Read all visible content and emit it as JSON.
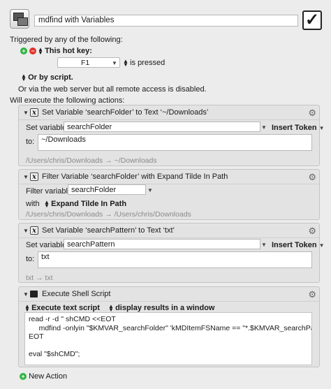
{
  "macro": {
    "name": "mdfind with Variables",
    "enabled_mark": "✓",
    "triggered_by": "Triggered by any of the following:",
    "hotkey_title": "This hot key:",
    "hotkey_value": "F1",
    "is_pressed": "is pressed",
    "or_by_script": "Or by script.",
    "web_server_note": "Or via the web server but all remote access is disabled.",
    "will_execute": "Will execute the following actions:",
    "new_action": "New Action"
  },
  "actions": [
    {
      "title": "Set Variable ‘searchFolder’ to Text ‘~/Downloads’",
      "set_label": "Set variable",
      "variable": "searchFolder",
      "insert_token": "Insert Token",
      "to_label": "to:",
      "text": "~/Downloads",
      "preview": "/Users/chris/Downloads → ~/Downloads"
    },
    {
      "title": "Filter Variable ‘searchFolder’ with Expand Tilde In Path",
      "filter_label": "Filter variable",
      "variable": "searchFolder",
      "with_label": "with",
      "filter": "Expand Tilde In Path",
      "preview": "/Users/chris/Downloads → /Users/chris/Downloads"
    },
    {
      "title": "Set Variable ‘searchPattern’ to Text ‘txt’",
      "set_label": "Set variable",
      "variable": "searchPattern",
      "insert_token": "Insert Token",
      "to_label": "to:",
      "text": "txt",
      "preview": "txt → txt"
    },
    {
      "title": "Execute Shell Script",
      "mode": "Execute text script",
      "output": "display results in a window",
      "script": "read -r -d '' shCMD <<EOT\n     mdfind -onlyin \"$KMVAR_searchFolder\" 'kMDItemFSName == \"*.$KMVAR_searchPattern\"c'\nEOT\n\neval \"$shCMD\";"
    }
  ]
}
